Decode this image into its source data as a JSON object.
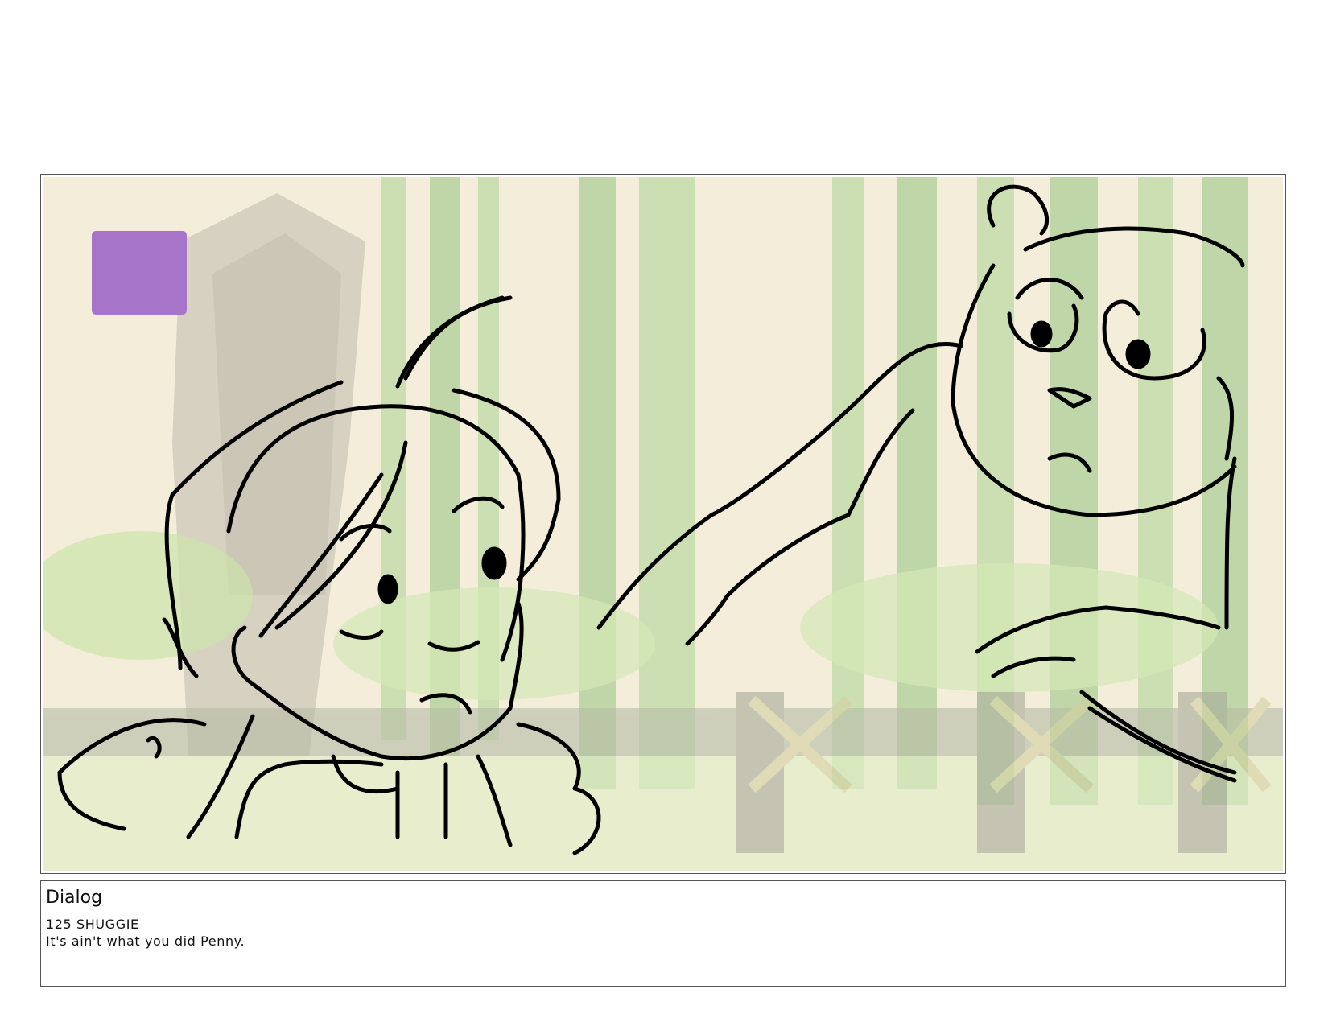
{
  "panel": {
    "marker_color": "#a675c9",
    "background_colors": {
      "sky": "#efe7cc",
      "bamboo": "#a9cf8a",
      "bamboo_dark": "#93bf78",
      "temple": "#a9a491",
      "fence": "#9fa688",
      "grass": "#c6df9c"
    },
    "characters": [
      "girl-sketch",
      "bear-sketch"
    ]
  },
  "dialog": {
    "heading": "Dialog",
    "speaker": "125 SHUGGIE",
    "line": "It's ain't what you did Penny."
  }
}
